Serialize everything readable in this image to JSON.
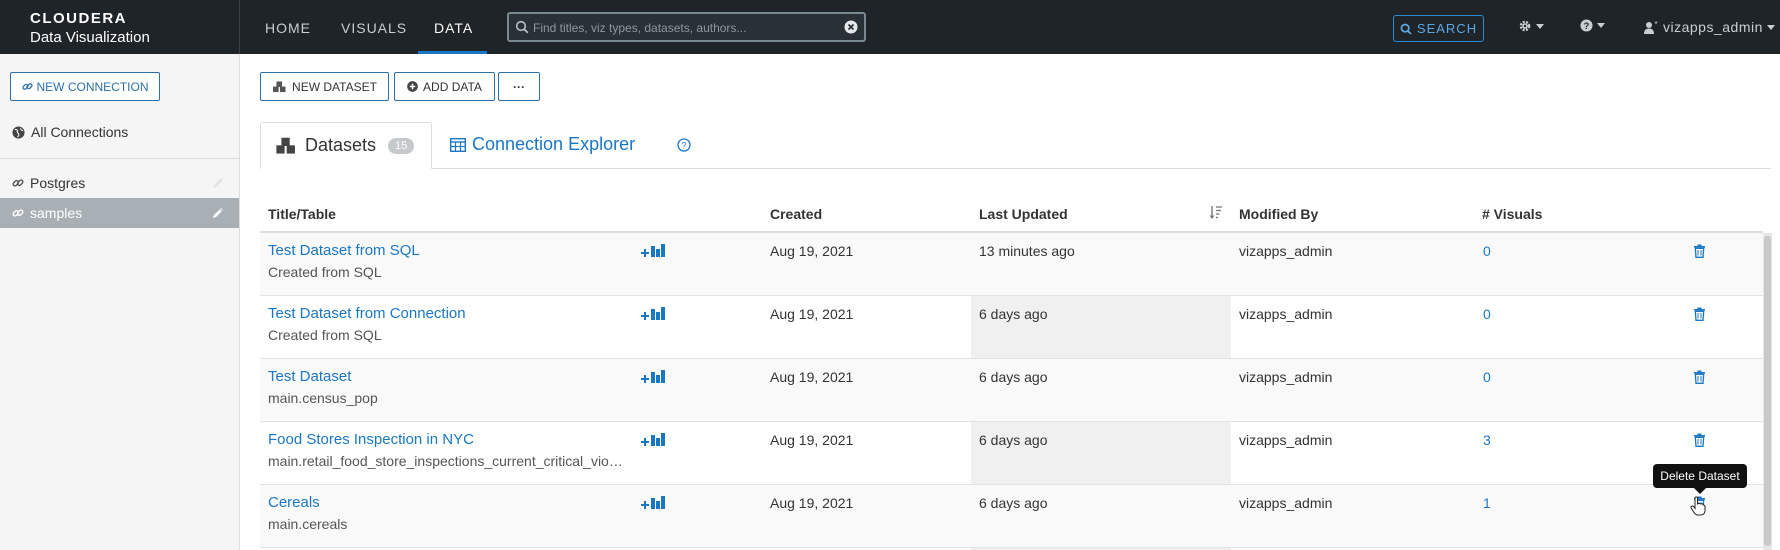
{
  "header": {
    "brand_line1": "CLOUDERA",
    "brand_line2": "Data Visualization",
    "nav": [
      "HOME",
      "VISUALS",
      "DATA"
    ],
    "search_placeholder": "Find titles, viz types, datasets, authors...",
    "search_button": "SEARCH",
    "user": "vizapps_admin",
    "accent_color": "#1a77c4"
  },
  "sidebar": {
    "new_connection": "NEW CONNECTION",
    "all_connections": "All Connections",
    "connections": [
      {
        "label": "Postgres",
        "selected": false
      },
      {
        "label": "samples",
        "selected": true
      }
    ]
  },
  "toolbar": {
    "new_dataset": "NEW DATASET",
    "add_data": "ADD DATA",
    "more": "···"
  },
  "tabs": {
    "datasets_label": "Datasets",
    "datasets_count": "15",
    "explorer_label": "Connection Explorer"
  },
  "table": {
    "headers": [
      "Title/Table",
      "Created",
      "Last Updated",
      "Modified By",
      "# Visuals"
    ],
    "rows": [
      {
        "title": "Test Dataset from SQL",
        "source": "Created from SQL",
        "created": "Aug 19, 2021",
        "updated": "13 minutes ago",
        "modified_by": "vizapps_admin",
        "visuals": "0"
      },
      {
        "title": "Test Dataset from Connection",
        "source": "Created from SQL",
        "created": "Aug 19, 2021",
        "updated": "6 days ago",
        "modified_by": "vizapps_admin",
        "visuals": "0"
      },
      {
        "title": "Test Dataset",
        "source": "main.census_pop",
        "created": "Aug 19, 2021",
        "updated": "6 days ago",
        "modified_by": "vizapps_admin",
        "visuals": "0"
      },
      {
        "title": "Food Stores Inspection in NYC",
        "source": "main.retail_food_store_inspections_current_critical_vio…",
        "created": "Aug 19, 2021",
        "updated": "6 days ago",
        "modified_by": "vizapps_admin",
        "visuals": "3"
      },
      {
        "title": "Cereals",
        "source": "main.cereals",
        "created": "Aug 19, 2021",
        "updated": "6 days ago",
        "modified_by": "vizapps_admin",
        "visuals": "1"
      }
    ]
  },
  "tooltip": "Delete Dataset"
}
